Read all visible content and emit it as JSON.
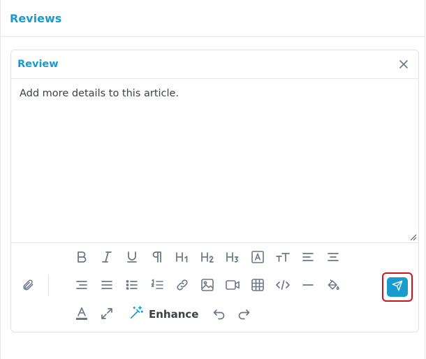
{
  "panel": {
    "title": "Reviews"
  },
  "card": {
    "title": "Review",
    "body_text": "Add more details to this article."
  },
  "toolbar": {
    "row1": [
      {
        "name": "bold-icon",
        "glyph": "B"
      },
      {
        "name": "italic-icon",
        "glyph": "I"
      },
      {
        "name": "underline-icon",
        "glyph": "U"
      },
      {
        "name": "paragraph-icon",
        "glyph": "¶"
      },
      {
        "name": "heading1-icon",
        "glyph": "H1"
      },
      {
        "name": "heading2-icon",
        "glyph": "H2"
      },
      {
        "name": "heading3-icon",
        "glyph": "H3"
      },
      {
        "name": "font-box-icon",
        "glyph": "A"
      },
      {
        "name": "text-size-icon",
        "glyph": "TT"
      },
      {
        "name": "align-left-icon",
        "glyph": ""
      },
      {
        "name": "align-center-icon",
        "glyph": ""
      }
    ],
    "row2": [
      {
        "name": "align-right-icon"
      },
      {
        "name": "align-justify-icon"
      },
      {
        "name": "bullet-list-icon"
      },
      {
        "name": "numbered-list-icon"
      },
      {
        "name": "link-icon"
      },
      {
        "name": "image-icon"
      },
      {
        "name": "video-icon"
      },
      {
        "name": "table-icon"
      },
      {
        "name": "code-icon"
      },
      {
        "name": "horizontal-rule-icon"
      },
      {
        "name": "paint-bucket-icon"
      }
    ],
    "row3": [
      {
        "name": "text-color-icon",
        "glyph": "A"
      },
      {
        "name": "expand-icon"
      }
    ],
    "enhance_label": "Enhance"
  },
  "colors": {
    "accent": "#1a9bd0",
    "icon": "#6b7787",
    "highlight_border": "#d0121b"
  }
}
